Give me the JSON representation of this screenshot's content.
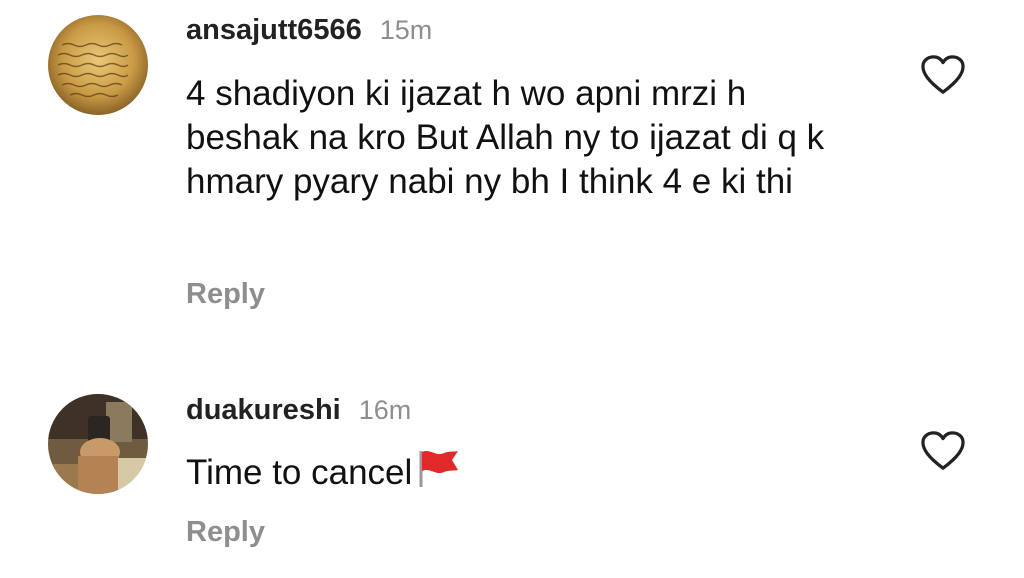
{
  "comments": [
    {
      "username": "ansajutt6566",
      "time": "15m",
      "text": "4 shadiyon ki ijazat h wo apni mrzi h beshak na kro But Allah ny to ijazat di q k hmary pyary nabi ny bh I think 4 e ki thi",
      "reply_label": "Reply",
      "avatar_icon": "manuscript-avatar",
      "like_icon": "heart-outline-icon"
    },
    {
      "username": "duakureshi",
      "time": "16m",
      "text": "Time to cancel",
      "emoji": "red-flag-emoji",
      "reply_label": "Reply",
      "avatar_icon": "selfie-avatar",
      "like_icon": "heart-outline-icon"
    }
  ],
  "colors": {
    "muted": "#8e8e8e",
    "text": "#111111",
    "flag": "#e02a2a"
  }
}
